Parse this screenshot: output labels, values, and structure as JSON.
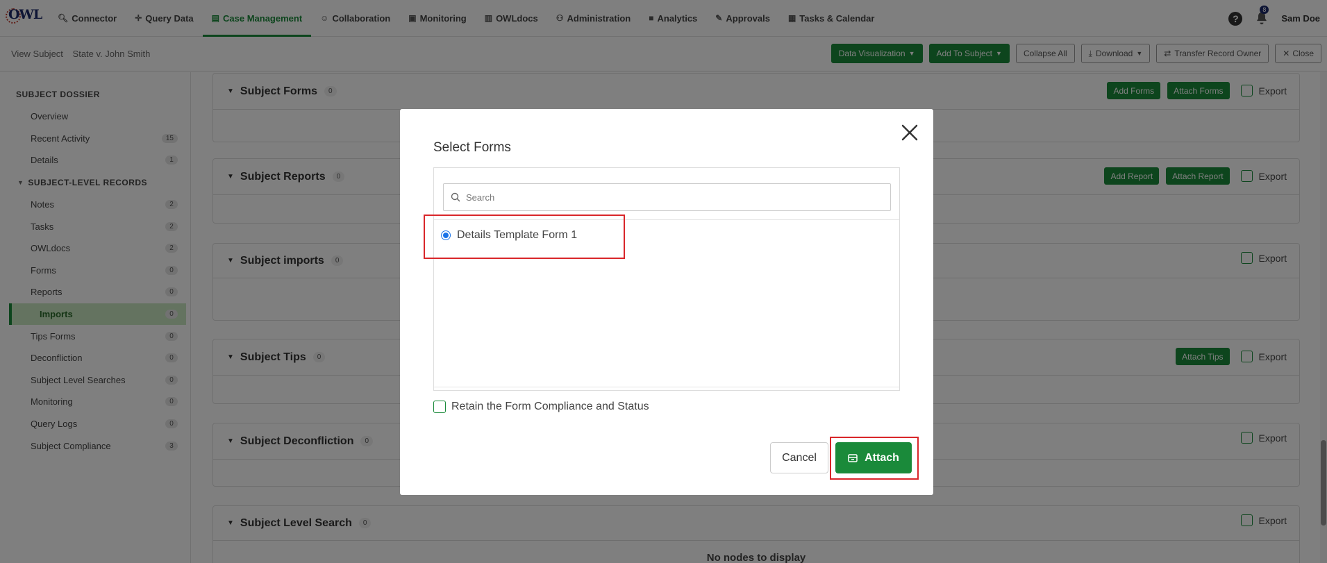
{
  "nav": {
    "items": [
      {
        "label": "Connector",
        "icon": "search-icon"
      },
      {
        "label": "Query Data",
        "icon": "move-icon"
      },
      {
        "label": "Case Management",
        "icon": "file-icon",
        "active": true
      },
      {
        "label": "Collaboration",
        "icon": "users-icon"
      },
      {
        "label": "Monitoring",
        "icon": "monitor-icon"
      },
      {
        "label": "OWLdocs",
        "icon": "docs-icon"
      },
      {
        "label": "Administration",
        "icon": "admin-icon"
      },
      {
        "label": "Analytics",
        "icon": "chart-file-icon"
      },
      {
        "label": "Approvals",
        "icon": "approval-icon"
      },
      {
        "label": "Tasks & Calendar",
        "icon": "calendar-icon"
      }
    ],
    "notifications_count": "8",
    "user": "Sam Doe"
  },
  "subheader": {
    "view_label": "View Subject",
    "subject_name": "State v. John Smith",
    "buttons": {
      "data_viz": "Data Visualization",
      "add_to_subject": "Add To Subject",
      "collapse_all": "Collapse All",
      "download": "Download",
      "transfer": "Transfer Record Owner",
      "close": "Close"
    }
  },
  "sidebar": {
    "dossier_heading": "SUBJECT DOSSIER",
    "records_heading": "SUBJECT-LEVEL RECORDS",
    "dossier_items": [
      {
        "label": "Overview",
        "count": ""
      },
      {
        "label": "Recent Activity",
        "count": "15"
      },
      {
        "label": "Details",
        "count": "1"
      }
    ],
    "record_items": [
      {
        "label": "Notes",
        "count": "2"
      },
      {
        "label": "Tasks",
        "count": "2"
      },
      {
        "label": "OWLdocs",
        "count": "2"
      },
      {
        "label": "Forms",
        "count": "0"
      },
      {
        "label": "Reports",
        "count": "0"
      },
      {
        "label": "Imports",
        "count": "0",
        "active": true
      },
      {
        "label": "Tips Forms",
        "count": "0"
      },
      {
        "label": "Deconfliction",
        "count": "0"
      },
      {
        "label": "Subject Level Searches",
        "count": "0"
      },
      {
        "label": "Monitoring",
        "count": "0"
      },
      {
        "label": "Query Logs",
        "count": "0"
      },
      {
        "label": "Subject Compliance",
        "count": "3"
      }
    ]
  },
  "sections": {
    "forms": {
      "title": "Subject Forms",
      "count": "0",
      "add": "Add Forms",
      "attach": "Attach Forms"
    },
    "reports": {
      "title": "Subject Reports",
      "count": "0",
      "add": "Add Report",
      "attach": "Attach Report"
    },
    "imports": {
      "title": "Subject imports",
      "count": "0"
    },
    "tips": {
      "title": "Subject Tips",
      "count": "0",
      "attach": "Attach Tips"
    },
    "deconfliction": {
      "title": "Subject Deconfliction",
      "count": "0"
    },
    "search": {
      "title": "Subject Level Search",
      "count": "0",
      "empty": "No nodes to display"
    },
    "export_label": "Export"
  },
  "modal": {
    "title": "Select Forms",
    "search_placeholder": "Search",
    "options": [
      {
        "label": "Details Template Form 1",
        "selected": true
      }
    ],
    "retain_label": "Retain the Form Compliance and Status",
    "cancel": "Cancel",
    "attach": "Attach"
  },
  "colors": {
    "accent": "#1a8a3a",
    "highlight": "#d9262a",
    "radio": "#1a73e8"
  }
}
